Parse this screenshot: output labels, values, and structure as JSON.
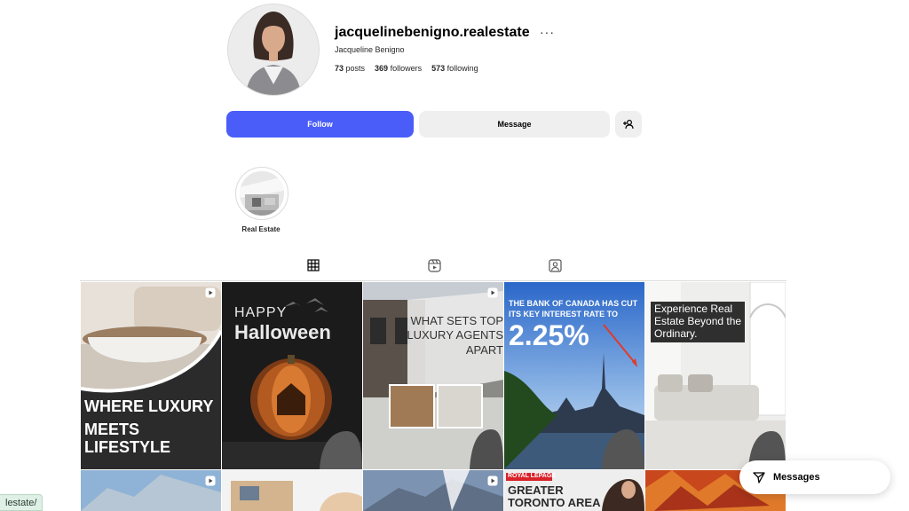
{
  "profile": {
    "username": "jacquelinebenigno.realestate",
    "full_name": "Jacqueline Benigno",
    "posts_count": "73",
    "posts_label": "posts",
    "followers_count": "369",
    "followers_label": "followers",
    "following_count": "573",
    "following_label": "following",
    "more_icon": "···"
  },
  "actions": {
    "follow_label": "Follow",
    "message_label": "Message",
    "add_user_icon": "add-user-icon"
  },
  "highlights": [
    {
      "label": "Real Estate"
    }
  ],
  "tabs": [
    {
      "name": "posts",
      "icon": "grid-icon",
      "active": true
    },
    {
      "name": "reels",
      "icon": "reels-icon",
      "active": false
    },
    {
      "name": "tagged",
      "icon": "tagged-icon",
      "active": false
    }
  ],
  "posts": [
    {
      "title_line1": "WHERE LUXURY",
      "title_line2": "MEETS LIFESTYLE",
      "is_reel": true
    },
    {
      "title_line1": "HAPPY",
      "title_line2": "Halloween",
      "is_reel": false
    },
    {
      "title_line1": "WHAT SETS TOP",
      "title_line2": "LUXURY AGENTS",
      "title_line3": "APART",
      "is_reel": true
    },
    {
      "title_line1": "THE BANK OF CANADA HAS CUT",
      "title_line2": "ITS KEY INTEREST RATE TO",
      "rate": "2.25%",
      "is_reel": false
    },
    {
      "title_line1": "Experience Real",
      "title_line2": "Estate Beyond the",
      "title_line3": "Ordinary.",
      "is_reel": false
    },
    {
      "is_reel": true
    },
    {
      "is_reel": false
    },
    {
      "is_reel": false
    },
    {
      "is_reel": true
    },
    {
      "title_line1": "ROYAL LEPAGE",
      "title_line2": "GREATER",
      "title_line3": "TORONTO AREA",
      "is_reel": false
    },
    {
      "is_reel": false
    }
  ],
  "messages": {
    "label": "Messages"
  },
  "status_url": "lestate/",
  "colors": {
    "follow_button": "#4a5df9",
    "secondary_button": "#efefef",
    "border": "#dbdbdb"
  }
}
